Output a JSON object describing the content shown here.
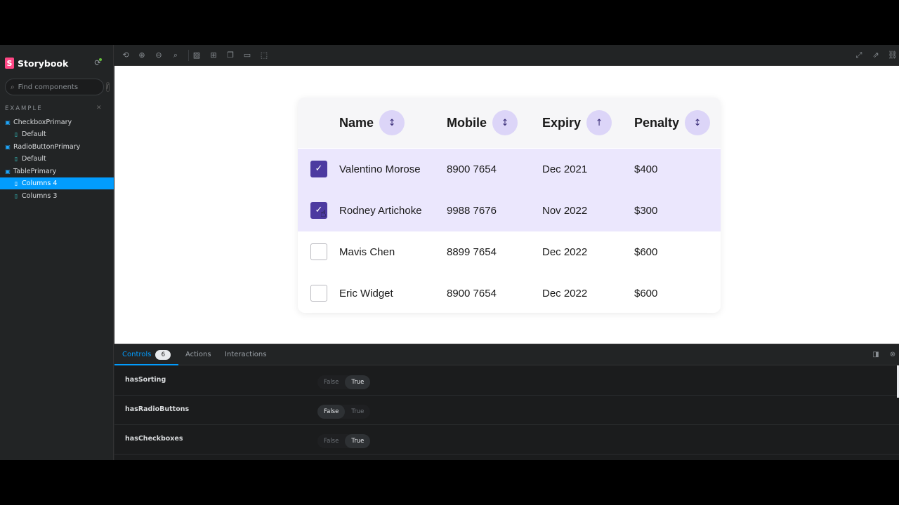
{
  "sidebar": {
    "brand_logo": "S",
    "brand": "Storybook",
    "search_placeholder": "Find components",
    "search_shortcut": "/",
    "section": "EXAMPLE",
    "items": [
      {
        "label": "CheckboxPrimary",
        "kind": "component"
      },
      {
        "label": "Default",
        "kind": "story"
      },
      {
        "label": "RadioButtonPrimary",
        "kind": "component"
      },
      {
        "label": "Default",
        "kind": "story"
      },
      {
        "label": "TablePrimary",
        "kind": "component"
      },
      {
        "label": "Columns 4",
        "kind": "story",
        "active": true
      },
      {
        "label": "Columns 3",
        "kind": "story"
      }
    ]
  },
  "table": {
    "headers": [
      "Name",
      "Mobile",
      "Expiry",
      "Penalty"
    ],
    "sort_icons": [
      "↕",
      "↕",
      "↑",
      "↕"
    ],
    "rows": [
      {
        "checked": true,
        "name": "Valentino Morose",
        "mobile": "8900 7654",
        "expiry": "Dec 2021",
        "penalty": "$400"
      },
      {
        "checked": true,
        "name": "Rodney Artichoke",
        "mobile": "9988 7676",
        "expiry": "Nov 2022",
        "penalty": "$300"
      },
      {
        "checked": false,
        "name": "Mavis Chen",
        "mobile": "8899 7654",
        "expiry": "Dec 2022",
        "penalty": "$600"
      },
      {
        "checked": false,
        "name": "Eric Widget",
        "mobile": "8900 7654",
        "expiry": "Dec 2022",
        "penalty": "$600"
      }
    ]
  },
  "panel": {
    "tabs": [
      {
        "label": "Controls",
        "badge": "6"
      },
      {
        "label": "Actions"
      },
      {
        "label": "Interactions"
      }
    ],
    "controls": [
      {
        "name": "hasSorting",
        "false_label": "False",
        "true_label": "True",
        "value": true
      },
      {
        "name": "hasRadioButtons",
        "false_label": "False",
        "true_label": "True",
        "value": false
      },
      {
        "name": "hasCheckboxes",
        "false_label": "False",
        "true_label": "True",
        "value": true
      }
    ]
  },
  "colors": {
    "accent": "#029cfd",
    "storybook_pink": "#ff4785",
    "selected_row": "#ebe7fd",
    "checkbox_checked": "#4c3aa0",
    "sort_button": "#dcd5f8"
  }
}
